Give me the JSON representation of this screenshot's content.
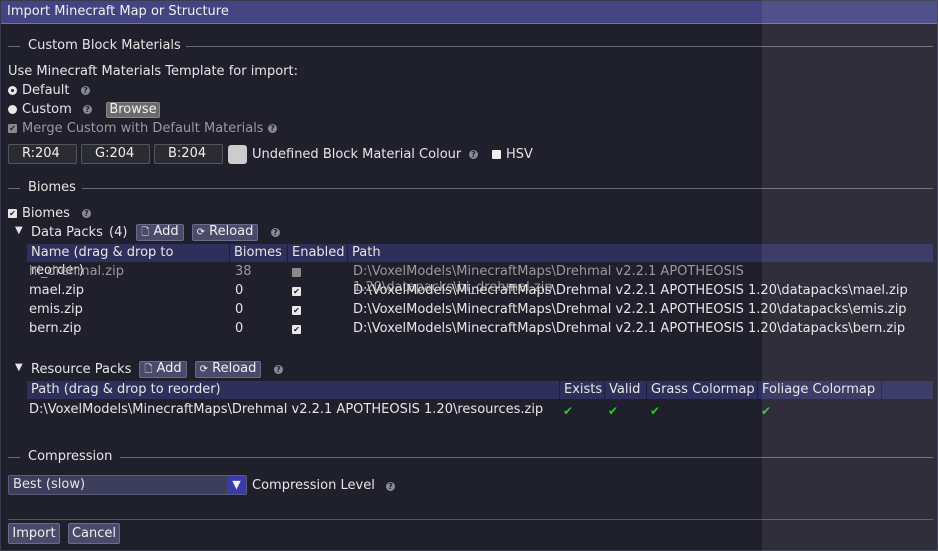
{
  "window": {
    "title": "Import Minecraft Map or Structure"
  },
  "help_glyph": "?",
  "materials": {
    "section_title": "Custom Block Materials",
    "template_label": "Use Minecraft Materials Template for import:",
    "default_label": "Default",
    "custom_label": "Custom",
    "browse_label": "Browse",
    "merge_label": "Merge Custom with Default Materials",
    "r_value": "R:204",
    "g_value": "G:204",
    "b_value": "B:204",
    "undefined_label": "Undefined Block Material Colour",
    "hsv_label": "HSV",
    "colour_swatch": "#cccccc"
  },
  "biomes": {
    "section_title": "Biomes",
    "checkbox_label": "Biomes",
    "datapacks": {
      "title": "Data Packs",
      "count": "(4)",
      "add_label": "Add",
      "reload_label": "Reload",
      "columns": [
        "Name (drag & drop to reorder)",
        "Biomes",
        "Enabled",
        "Path"
      ],
      "rows": [
        {
          "name": "hi_drehmal.zip",
          "biomes": "38",
          "enabled": false,
          "path": "D:\\VoxelModels\\MinecraftMaps\\Drehmal v2.2.1 APOTHEOSIS 1.20\\datapacks\\hi_drehmal.zip"
        },
        {
          "name": "mael.zip",
          "biomes": "0",
          "enabled": true,
          "path": "D:\\VoxelModels\\MinecraftMaps\\Drehmal v2.2.1 APOTHEOSIS 1.20\\datapacks\\mael.zip"
        },
        {
          "name": "emis.zip",
          "biomes": "0",
          "enabled": true,
          "path": "D:\\VoxelModels\\MinecraftMaps\\Drehmal v2.2.1 APOTHEOSIS 1.20\\datapacks\\emis.zip"
        },
        {
          "name": "bern.zip",
          "biomes": "0",
          "enabled": true,
          "path": "D:\\VoxelModels\\MinecraftMaps\\Drehmal v2.2.1 APOTHEOSIS 1.20\\datapacks\\bern.zip"
        }
      ]
    },
    "resourcepacks": {
      "title": "Resource Packs",
      "add_label": "Add",
      "reload_label": "Reload",
      "columns": [
        "Path (drag & drop to reorder)",
        "Exists",
        "Valid",
        "Grass Colormap",
        "Foliage Colormap"
      ],
      "rows": [
        {
          "path": "D:\\VoxelModels\\MinecraftMaps\\Drehmal v2.2.1 APOTHEOSIS 1.20\\resources.zip",
          "exists": true,
          "valid": true,
          "grass": true,
          "foliage": true
        }
      ]
    }
  },
  "compression": {
    "section_title": "Compression",
    "selected": "Best (slow)",
    "level_label": "Compression Level"
  },
  "footer": {
    "import_label": "Import",
    "cancel_label": "Cancel"
  },
  "colors": {
    "title_bar": "#444482",
    "background": "#201f2c",
    "table_header": "#2f2f5c",
    "tick": "#22cc22"
  }
}
